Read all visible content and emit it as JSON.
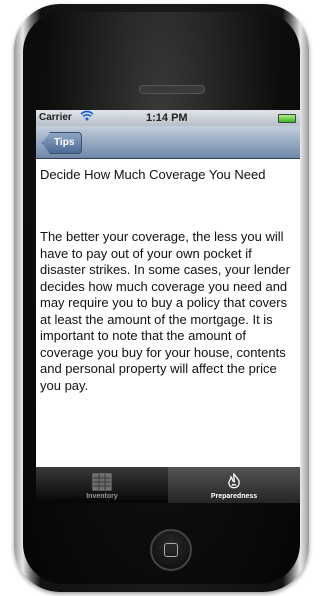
{
  "status_bar": {
    "carrier": "Carrier",
    "time": "1:14 PM",
    "wifi_icon": "wifi-icon",
    "battery_icon": "battery-icon"
  },
  "navbar": {
    "back_label": "Tips"
  },
  "content": {
    "heading": "Decide How Much Coverage You Need",
    "body": "The better your coverage, the less you will have to pay out of your own pocket if disaster strikes. In some cases, your lender decides how much coverage you need and may require you to buy a policy that covers at least the amount of the mortgage. It is important to note that the amount of coverage you buy for your house, contents and personal property will affect the price you pay."
  },
  "tabbar": {
    "tabs": [
      {
        "label": "Inventory",
        "icon": "inventory-icon",
        "selected": false
      },
      {
        "label": "Preparedness",
        "icon": "flame-icon",
        "selected": true
      }
    ]
  },
  "colors": {
    "navbar": "#6e87a8",
    "tabbar": "#050505",
    "selected_tab_text": "#ffffff"
  }
}
